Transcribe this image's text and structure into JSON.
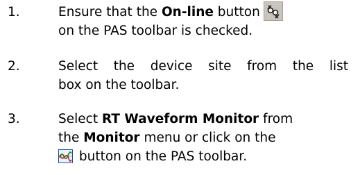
{
  "steps": [
    {
      "number": "1.",
      "line1_pre": "Ensure that the ",
      "line1_bold": "On-line",
      "line1_post": " button",
      "icon": "online-connection-icon",
      "line2": "on the PAS toolbar is checked."
    },
    {
      "number": "2.",
      "line1": "Select the device site from the list",
      "line2": "box on the toolbar."
    },
    {
      "number": "3.",
      "line1_pre": "Select ",
      "line1_bold": "RT Waveform Monitor",
      "line1_post": " from",
      "line2_pre": "the ",
      "line2_bold": "Monitor",
      "line2_post": " menu or click on the",
      "icon": "rt-waveform-monitor-icon",
      "line3": " button on the PAS toolbar."
    }
  ],
  "colors": {
    "text": "#000000",
    "icon_bg": "#c9c4bc",
    "waveform_green": "#1f8f1f",
    "waveform_red": "#d01818"
  }
}
